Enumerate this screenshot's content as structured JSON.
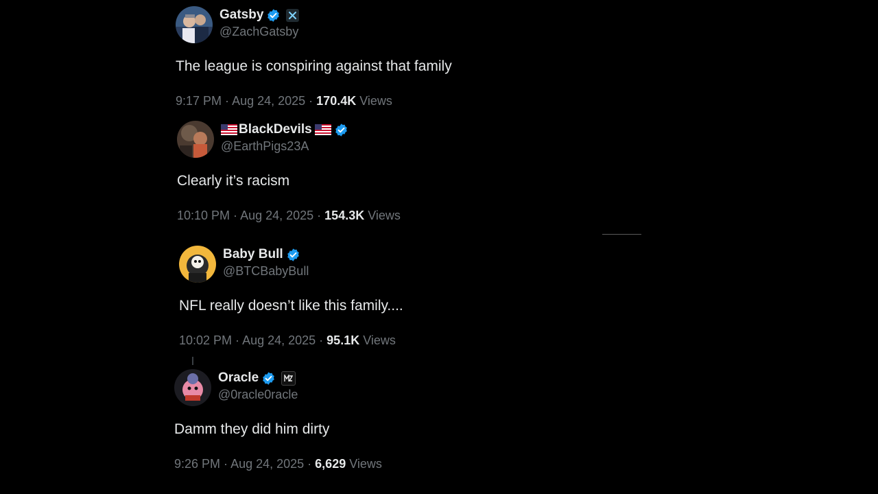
{
  "tweets": [
    {
      "display_name": "Gatsby",
      "handle": "@ZachGatsby",
      "text": "The league is conspiring against that family",
      "time": "9:17 PM",
      "date": "Aug 24, 2025",
      "views_count": "170.4K",
      "views_label": "Views",
      "badge": "x-affiliate-icon",
      "verified_color": "#1d9bf0"
    },
    {
      "display_name": "BlackDevils",
      "handle": "@EarthPigs23A",
      "text": "Clearly it’s racism",
      "time": "10:10 PM",
      "date": "Aug 24, 2025",
      "views_count": "154.3K",
      "views_label": "Views",
      "flags": [
        "us-flag-icon",
        "us-flag-icon"
      ],
      "verified_color": "#1d9bf0"
    },
    {
      "display_name": "Baby Bull",
      "handle": "@BTCBabyBull",
      "text": "NFL really doesn’t like this family....",
      "time": "10:02 PM",
      "date": "Aug 24, 2025",
      "views_count": "95.1K",
      "views_label": "Views",
      "verified_color": "#1d9bf0"
    },
    {
      "display_name": "Oracle",
      "handle": "@0racle0racle",
      "text": "Damm they did him dirty",
      "time": "9:26 PM",
      "date": "Aug 24, 2025",
      "views_count": "6,629",
      "views_label": "Views",
      "badge": "mz-affiliate-icon",
      "verified_color": "#1d9bf0"
    }
  ],
  "separator": " · "
}
